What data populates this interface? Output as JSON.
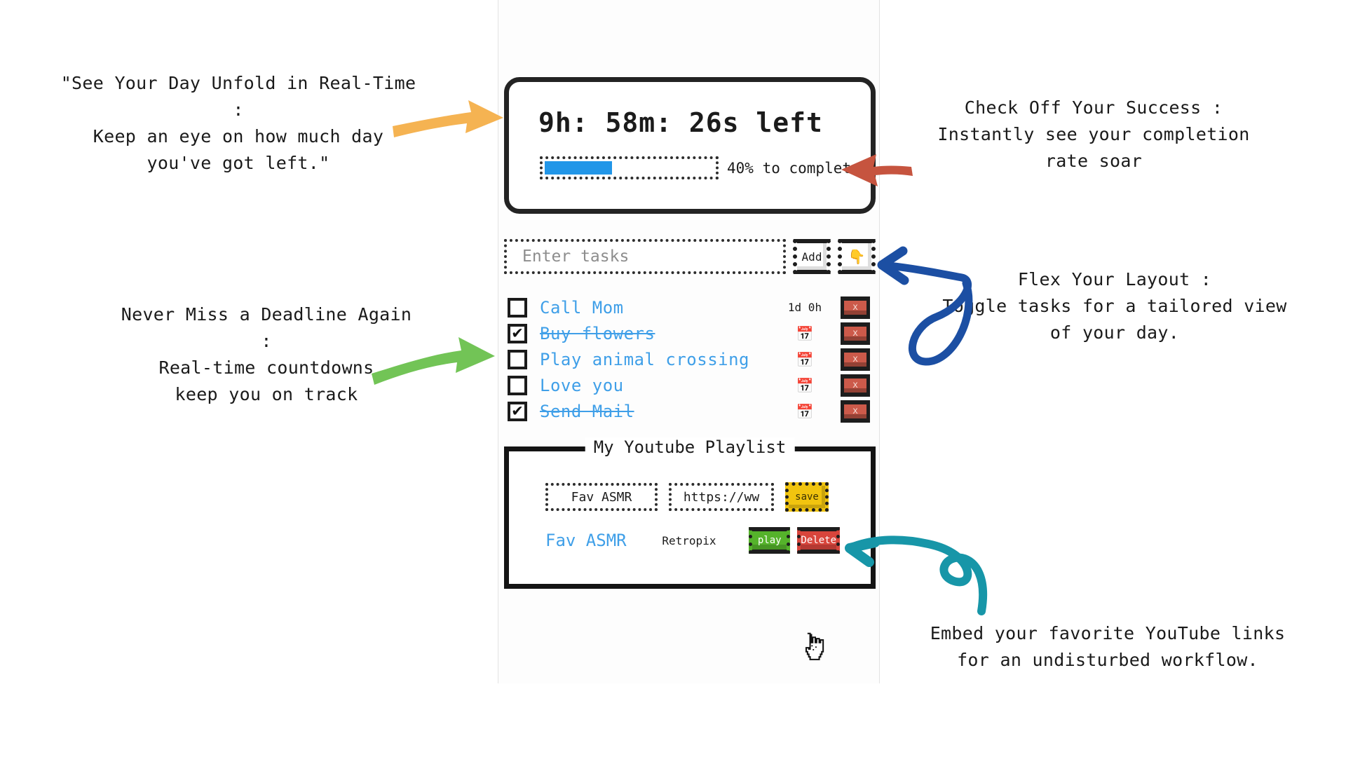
{
  "annotations": {
    "top_left": "\"See Your Day Unfold in Real-Time\n:\nKeep an eye on how much day\nyou've got left.\"",
    "top_right": "Check Off Your Success :\nInstantly see your completion\nrate soar",
    "left_middle": "Never Miss a Deadline Again\n:\nReal-time countdowns\nkeep you on track",
    "right_middle": "Flex Your Layout :\nToggle tasks for a tailored view\nof your day.",
    "bottom_right": "Embed your favorite YouTube links\nfor an undisturbed workflow."
  },
  "timer": {
    "countdown": "9h: 58m: 26s left",
    "progress_percent": 40,
    "progress_label": "40% to complete"
  },
  "input_row": {
    "placeholder": "Enter tasks",
    "value": "",
    "add_label": "Add",
    "toggle_icon": "hand-pointer-icon",
    "toggle_glyph": "👇"
  },
  "tasks": [
    {
      "label": "Call Mom",
      "checked": false,
      "done": false,
      "meta": "1d 0h",
      "meta_type": "text",
      "delete_label": "x"
    },
    {
      "label": "Buy flowers",
      "checked": true,
      "done": true,
      "meta": "",
      "meta_type": "calendar",
      "delete_label": "x"
    },
    {
      "label": "Play animal crossing",
      "checked": false,
      "done": false,
      "meta": "",
      "meta_type": "calendar",
      "delete_label": "x"
    },
    {
      "label": "Love you",
      "checked": false,
      "done": false,
      "meta": "",
      "meta_type": "calendar",
      "delete_label": "x"
    },
    {
      "label": "Send Mail",
      "checked": true,
      "done": true,
      "meta": "",
      "meta_type": "calendar",
      "delete_label": "x"
    }
  ],
  "youtube": {
    "title": "My Youtube Playlist",
    "name_value": "Fav ASMR",
    "name_placeholder": "Fav ASMR",
    "url_value": "https://ww",
    "url_placeholder": "https://ww",
    "save_label": "save",
    "entry": {
      "link_text": "Fav ASMR",
      "channel": "Retropix",
      "play_label": "play",
      "delete_label": "Delete"
    }
  },
  "colors": {
    "progress_fill": "#2196e8",
    "task_text": "#3f9fe8",
    "calendar_icon": "#2d8fe0",
    "delete_red": "#cc5a4a",
    "save_yellow": "#f1c40f",
    "play_green": "#55b32b",
    "delete_button_red": "#d8453c",
    "arrow_orange": "#f5b352",
    "arrow_red": "#c6543f",
    "arrow_green": "#72c456",
    "arrow_blue": "#1c4fa3",
    "arrow_teal": "#1796a8",
    "outline_dark": "#232323"
  },
  "cursor": {
    "icon": "pointing-hand-cursor"
  }
}
